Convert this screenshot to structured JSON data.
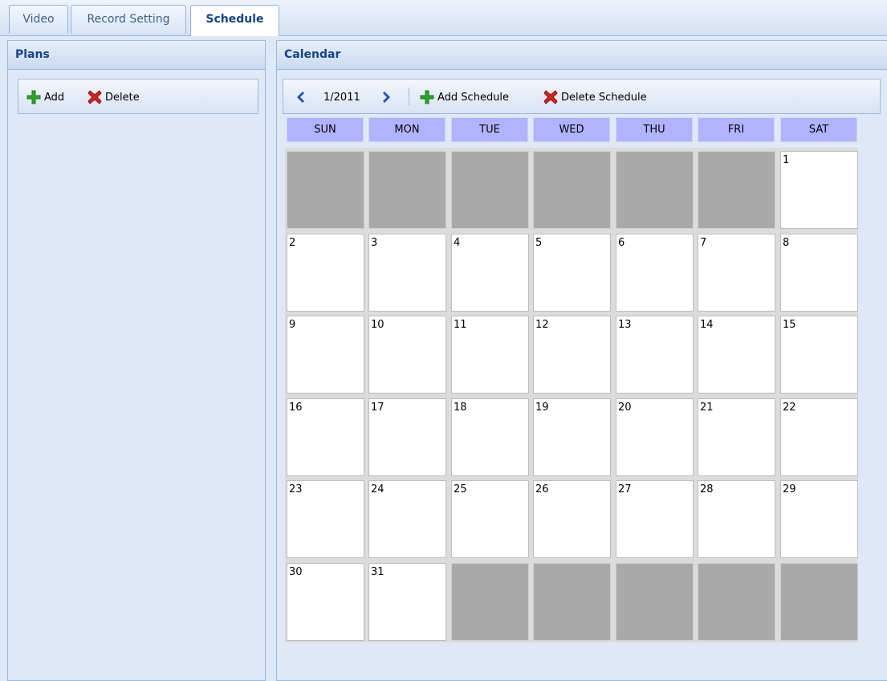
{
  "tabs": [
    {
      "label": "Video"
    },
    {
      "label": "Record Setting"
    },
    {
      "label": "Schedule",
      "active": true
    }
  ],
  "plans": {
    "title": "Plans",
    "add_label": "Add",
    "delete_label": "Delete"
  },
  "calendar": {
    "title": "Calendar",
    "month_label": "1/2011",
    "add_schedule_label": "Add Schedule",
    "delete_schedule_label": "Delete Schedule",
    "weekdays": [
      "SUN",
      "MON",
      "TUE",
      "WED",
      "THU",
      "FRI",
      "SAT"
    ],
    "weeks": [
      [
        "",
        "",
        "",
        "",
        "",
        "",
        "1"
      ],
      [
        "2",
        "3",
        "4",
        "5",
        "6",
        "7",
        "8"
      ],
      [
        "9",
        "10",
        "11",
        "12",
        "13",
        "14",
        "15"
      ],
      [
        "16",
        "17",
        "18",
        "19",
        "20",
        "21",
        "22"
      ],
      [
        "23",
        "24",
        "25",
        "26",
        "27",
        "28",
        "29"
      ],
      [
        "30",
        "31",
        "",
        "",
        "",
        "",
        ""
      ]
    ]
  },
  "colors": {
    "header_text": "#15428b",
    "weekday_header": "#b0b3ff",
    "empty_day": "#a9a9a9"
  },
  "icons": {
    "add": "plus-icon",
    "delete": "x-icon",
    "prev": "chevron-left-icon",
    "next": "chevron-right-icon"
  }
}
